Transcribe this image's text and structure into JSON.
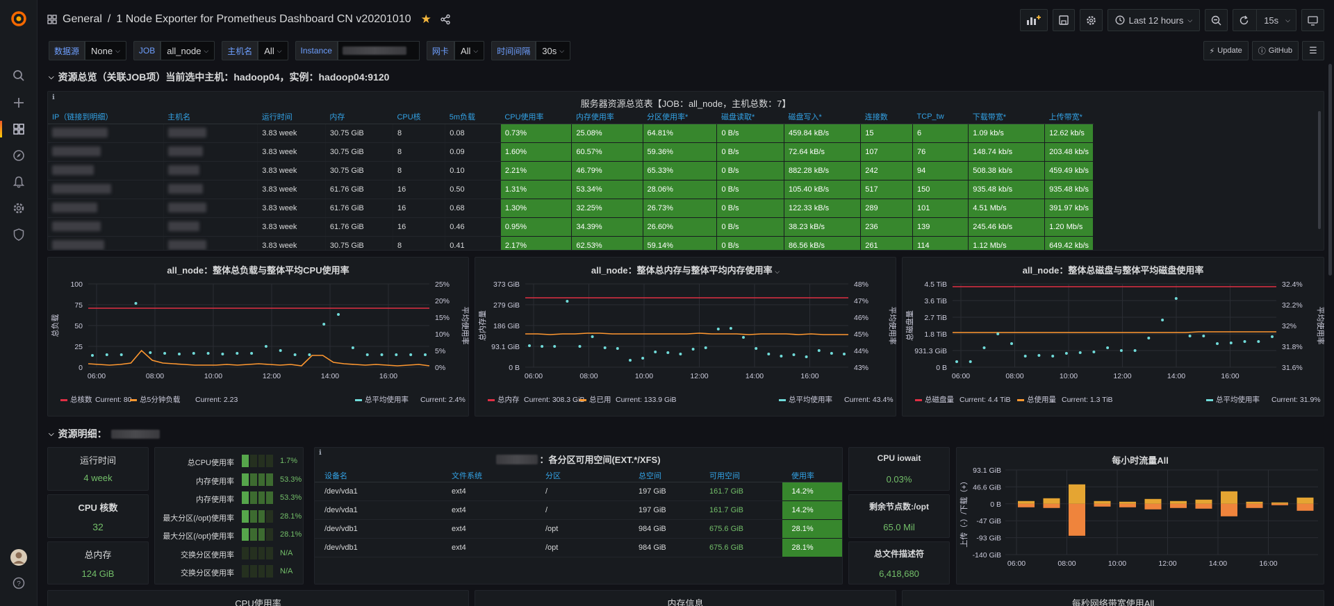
{
  "topbar": {
    "section": "General",
    "separator": "/",
    "title": "1 Node Exporter for Prometheus Dashboard CN v20201010",
    "time_range": "Last 12 hours",
    "refresh": "15s"
  },
  "variables": {
    "datasource_label": "数据源",
    "datasource_value": "None",
    "job_label": "JOB",
    "job_value": "all_node",
    "host_label": "主机名",
    "host_value": "All",
    "instance_label": "Instance",
    "nic_label": "网卡",
    "nic_value": "All",
    "interval_label": "时间间隔",
    "interval_value": "30s",
    "update_label": "Update",
    "github_label": "GitHub"
  },
  "row1": {
    "title": "资源总览（关联JOB项）当前选中主机：hadoop04，实例：hadoop04:9120"
  },
  "server_table": {
    "title": "服务器资源总览表【JOB：all_node，主机总数：7】",
    "columns": [
      "IP（链接到明细）",
      "主机名",
      "运行时间",
      "内存",
      "CPU核",
      "5m负载",
      "CPU使用率",
      "内存使用率",
      "分区使用率*",
      "磁盘读取*",
      "磁盘写入*",
      "连接数",
      "TCP_tw",
      "下载带宽*",
      "上传带宽*"
    ],
    "rows": [
      [
        "",
        "",
        "3.83 week",
        "30.75 GiB",
        "8",
        "0.08",
        "0.73%",
        "25.08%",
        "64.81%",
        "0 B/s",
        "459.84 kB/s",
        "15",
        "6",
        "1.09 kb/s",
        "12.62 kb/s"
      ],
      [
        "",
        "",
        "3.83 week",
        "30.75 GiB",
        "8",
        "0.09",
        "1.60%",
        "60.57%",
        "59.36%",
        "0 B/s",
        "72.64 kB/s",
        "107",
        "76",
        "148.74 kb/s",
        "203.48 kb/s"
      ],
      [
        "",
        "",
        "3.83 week",
        "30.75 GiB",
        "8",
        "0.10",
        "2.21%",
        "46.79%",
        "65.33%",
        "0 B/s",
        "882.28 kB/s",
        "242",
        "94",
        "508.38 kb/s",
        "459.49 kb/s"
      ],
      [
        "",
        "",
        "3.83 week",
        "61.76 GiB",
        "16",
        "0.50",
        "1.31%",
        "53.34%",
        "28.06%",
        "0 B/s",
        "105.40 kB/s",
        "517",
        "150",
        "935.48 kb/s",
        "935.48 kb/s"
      ],
      [
        "",
        "",
        "3.83 week",
        "61.76 GiB",
        "16",
        "0.68",
        "1.30%",
        "32.25%",
        "26.73%",
        "0 B/s",
        "122.33 kB/s",
        "289",
        "101",
        "4.51 Mb/s",
        "391.97 kb/s"
      ],
      [
        "",
        "",
        "3.83 week",
        "61.76 GiB",
        "16",
        "0.46",
        "0.95%",
        "34.39%",
        "26.60%",
        "0 B/s",
        "38.23 kB/s",
        "236",
        "139",
        "245.46 kb/s",
        "1.20 Mb/s"
      ],
      [
        "",
        "",
        "3.83 week",
        "30.75 GiB",
        "8",
        "0.41",
        "2.17%",
        "62.53%",
        "59.14%",
        "0 B/s",
        "86.56 kB/s",
        "261",
        "114",
        "1.12 Mb/s",
        "649.42 kb/s"
      ]
    ]
  },
  "charts": {
    "cpu": {
      "title": "all_node：整体总负载与整体平均CPU使用率",
      "ylabel_left": "总负载",
      "ylabel_right": "平均使用率",
      "left_ticks": [
        "100",
        "75",
        "50",
        "25",
        "0"
      ],
      "right_ticks": [
        "25%",
        "20%",
        "15%",
        "10%",
        "5%",
        "0%"
      ],
      "x_ticks": [
        "06:00",
        "08:00",
        "10:00",
        "12:00",
        "14:00",
        "16:00"
      ],
      "legend": [
        {
          "name": "总核数",
          "current": "Current: 80",
          "color": "#e02f44"
        },
        {
          "name": "总5分钟负载",
          "current": "Current: 2.23",
          "color": "#ff9830"
        },
        {
          "name": "总平均使用率",
          "current": "Current: 2.4%",
          "color": "#70dbd9"
        }
      ]
    },
    "mem": {
      "title": "all_node：整体总内存与整体平均内存使用率",
      "ylabel_left": "总内存量",
      "ylabel_right": "平均使用率",
      "left_ticks": [
        "373 GiB",
        "279 GiB",
        "186 GiB",
        "93.1 GiB",
        "0 B"
      ],
      "right_ticks": [
        "48%",
        "47%",
        "46%",
        "45%",
        "44%",
        "43%"
      ],
      "x_ticks": [
        "06:00",
        "08:00",
        "10:00",
        "12:00",
        "14:00",
        "16:00"
      ],
      "legend": [
        {
          "name": "总内存",
          "current": "Current: 308.3 GiB",
          "color": "#e02f44"
        },
        {
          "name": "总已用",
          "current": "Current: 133.9 GiB",
          "color": "#ff9830"
        },
        {
          "name": "总平均使用率",
          "current": "Current: 43.4%",
          "color": "#70dbd9"
        }
      ]
    },
    "disk": {
      "title": "all_node：整体总磁盘与整体平均磁盘使用率",
      "ylabel_left": "总磁盘量",
      "ylabel_right": "平均使用率",
      "left_ticks": [
        "4.5 TiB",
        "3.6 TiB",
        "2.7 TiB",
        "1.8 TiB",
        "931.3 GiB",
        "0 B"
      ],
      "right_ticks": [
        "32.4%",
        "32.2%",
        "32%",
        "31.8%",
        "31.6%"
      ],
      "x_ticks": [
        "06:00",
        "08:00",
        "10:00",
        "12:00",
        "14:00",
        "16:00"
      ],
      "legend": [
        {
          "name": "总磁盘量",
          "current": "Current: 4.4 TiB",
          "color": "#e02f44"
        },
        {
          "name": "总使用量",
          "current": "Current: 1.3 TiB",
          "color": "#ff9830"
        },
        {
          "name": "总平均使用率",
          "current": "Current: 31.9%",
          "color": "#70dbd9"
        }
      ]
    }
  },
  "row2": {
    "title": "资源明细："
  },
  "stats": {
    "uptime": {
      "title": "运行时间",
      "value": "4 week"
    },
    "cores": {
      "title": "CPU 核数",
      "value": "32"
    },
    "memory": {
      "title": "总内存",
      "value": "124 GiB"
    },
    "iowait": {
      "title": "CPU iowait",
      "value": "0.03%"
    },
    "inodes": {
      "title": "剩余节点数:/opt",
      "value": "65.0 Mil"
    },
    "fds": {
      "title": "总文件描述符",
      "value": "6,418,680"
    }
  },
  "gauges": [
    {
      "label": "总CPU使用率",
      "value": "1.7%",
      "level": 0.017
    },
    {
      "label": "内存使用率",
      "value": "53.3%",
      "level": 0.533
    },
    {
      "label": "内存使用率",
      "value": "53.3%",
      "level": 0.533
    },
    {
      "label": "最大分区(/opt)使用率",
      "value": "28.1%",
      "level": 0.281
    },
    {
      "label": "最大分区(/opt)使用率",
      "value": "28.1%",
      "level": 0.281
    },
    {
      "label": "交换分区使用率",
      "value": "N/A",
      "level": 0
    },
    {
      "label": "交换分区使用率",
      "value": "N/A",
      "level": 0
    }
  ],
  "fs_table": {
    "title": "：各分区可用空间(EXT.*/XFS)",
    "columns": [
      "设备名",
      "文件系统",
      "分区",
      "总空间",
      "可用空间",
      "使用率"
    ],
    "rows": [
      [
        "/dev/vda1",
        "ext4",
        "/",
        "197 GiB",
        "161.7 GiB",
        "14.2%"
      ],
      [
        "/dev/vda1",
        "ext4",
        "/",
        "197 GiB",
        "161.7 GiB",
        "14.2%"
      ],
      [
        "/dev/vdb1",
        "ext4",
        "/opt",
        "984 GiB",
        "675.6 GiB",
        "28.1%"
      ],
      [
        "/dev/vdb1",
        "ext4",
        "/opt",
        "984 GiB",
        "675.6 GiB",
        "28.1%"
      ]
    ]
  },
  "traffic": {
    "title": "每小时流量All",
    "ylabel": "上传（-）/下载（+）",
    "y_ticks": [
      "93.1 GiB",
      "46.6 GiB",
      "0 B",
      "-47 GiB",
      "-93 GiB",
      "-140 GiB"
    ],
    "x_ticks": [
      "06:00",
      "08:00",
      "10:00",
      "12:00",
      "14:00",
      "16:00"
    ]
  },
  "bottom_titles": [
    "CPU使用率",
    "内存信息",
    "每秒网络带宽使用All"
  ]
}
